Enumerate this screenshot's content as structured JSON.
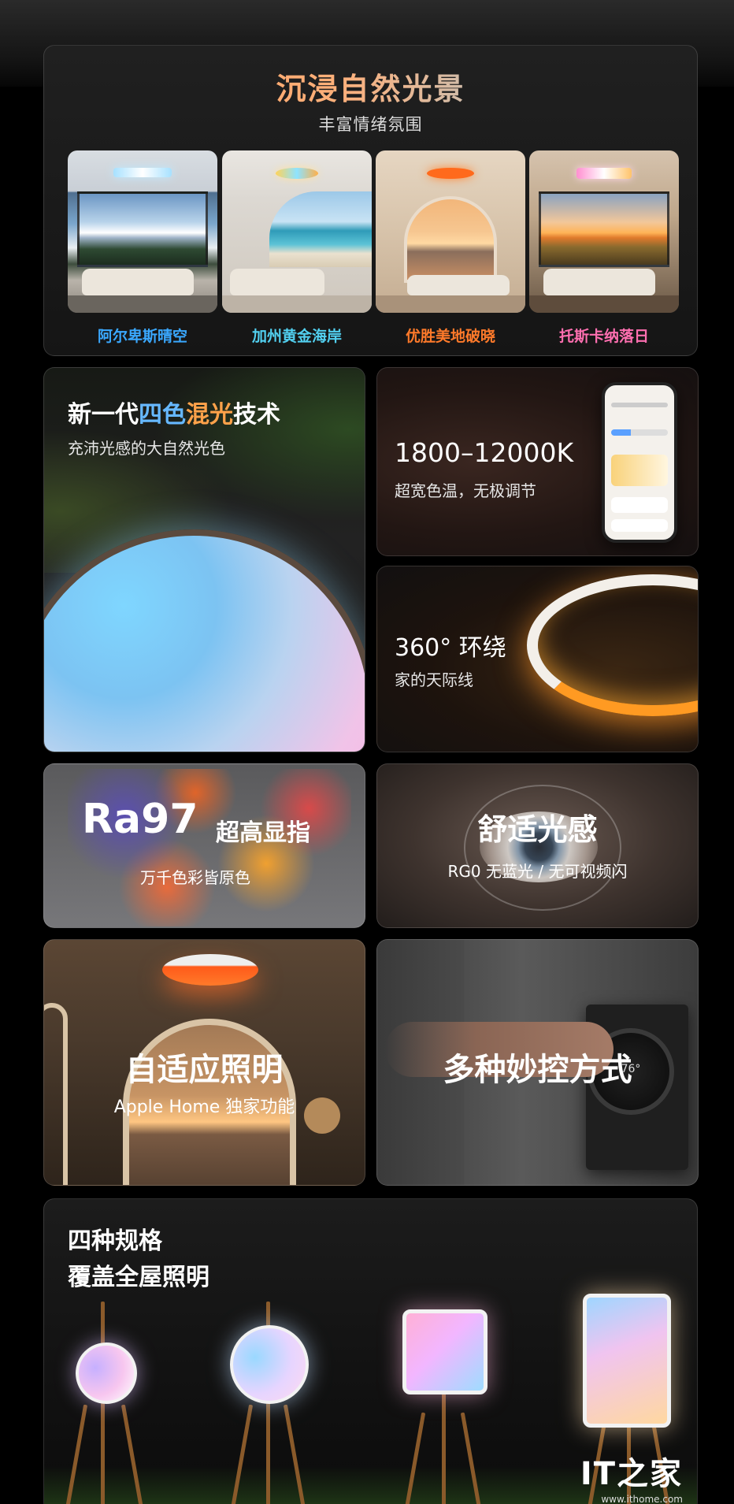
{
  "scenes_section": {
    "title": "沉浸自然光景",
    "subtitle": "丰富情绪氛围",
    "scenes": [
      {
        "label": "阿尔卑斯晴空",
        "label_color": "#3aa8ff"
      },
      {
        "label": "加州黄金海岸",
        "label_color": "#52d0f0"
      },
      {
        "label": "优胜美地破晓",
        "label_color": "#ff7a2a"
      },
      {
        "label": "托斯卡纳落日",
        "label_color": "#ff6fb0"
      }
    ]
  },
  "tech_card": {
    "title_prefix": "新一代",
    "title_highlight_1": "四色",
    "title_highlight_2": "混光",
    "title_suffix": "技术",
    "subtitle": "充沛光感的大自然光色",
    "highlight_color_1": "#66b8ff",
    "highlight_color_2": "#ffa24a"
  },
  "temp_card": {
    "title": "1800–12000K",
    "subtitle": "超宽色温，无极调节"
  },
  "ring_card": {
    "title": "360° 环绕",
    "subtitle": "家的天际线"
  },
  "ra_card": {
    "title_big": "Ra97",
    "title_rest": "超高显指",
    "subtitle": "万千色彩皆原色"
  },
  "comfort_card": {
    "title": "舒适光感",
    "subtitle": "RG0 无蓝光 / 无可视频闪"
  },
  "adaptive_card": {
    "title": "自适应照明",
    "subtitle": "Apple Home 独家功能"
  },
  "control_card": {
    "title": "多种妙控方式",
    "thermostat_reading": "76°"
  },
  "sizes_card": {
    "title_line1": "四种规格",
    "title_line2": "覆盖全屋照明"
  },
  "watermark": {
    "logo": "IT之家",
    "url": "www.ithome.com"
  }
}
